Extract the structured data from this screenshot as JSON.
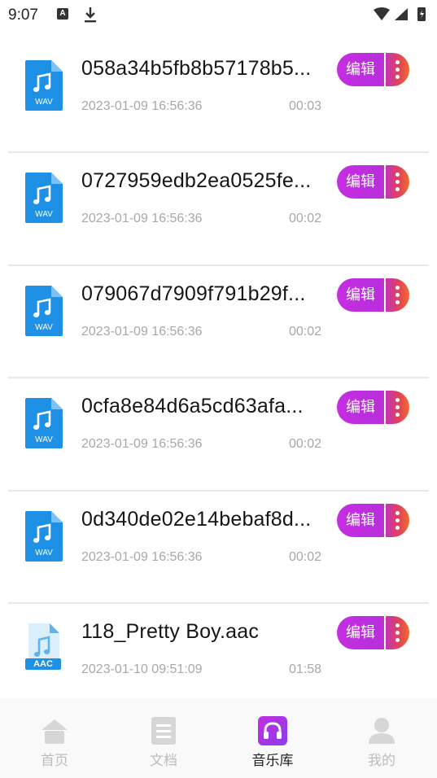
{
  "status_bar": {
    "time": "9:07",
    "notification_letter": "A"
  },
  "files": [
    {
      "name": "058a34b5fb8b57178b5...",
      "date": "2023-01-09 16:56:36",
      "duration": "00:03",
      "type": "WAV",
      "edit_label": "编辑"
    },
    {
      "name": "0727959edb2ea0525fe...",
      "date": "2023-01-09 16:56:36",
      "duration": "00:02",
      "type": "WAV",
      "edit_label": "编辑"
    },
    {
      "name": "079067d7909f791b29f...",
      "date": "2023-01-09 16:56:36",
      "duration": "00:02",
      "type": "WAV",
      "edit_label": "编辑"
    },
    {
      "name": "0cfa8e84d6a5cd63afa...",
      "date": "2023-01-09 16:56:36",
      "duration": "00:02",
      "type": "WAV",
      "edit_label": "编辑"
    },
    {
      "name": "0d340de02e14bebaf8d...",
      "date": "2023-01-09 16:56:36",
      "duration": "00:02",
      "type": "WAV",
      "edit_label": "编辑"
    },
    {
      "name": "118_Pretty Boy.aac",
      "date": "2023-01-10 09:51:09",
      "duration": "01:58",
      "type": "AAC",
      "edit_label": "编辑"
    }
  ],
  "tabs": [
    {
      "label": "首页",
      "icon": "home-icon",
      "active": false
    },
    {
      "label": "文档",
      "icon": "document-icon",
      "active": false
    },
    {
      "label": "音乐库",
      "icon": "headphones-icon",
      "active": true
    },
    {
      "label": "我的",
      "icon": "user-icon",
      "active": false
    }
  ],
  "colors": {
    "accent": "#c42ee0",
    "accent_end": "#f26a2e",
    "wav_icon": "#1e90e6",
    "aac_icon": "#5fb3ee",
    "inactive_tab": "#d6d6d6"
  }
}
